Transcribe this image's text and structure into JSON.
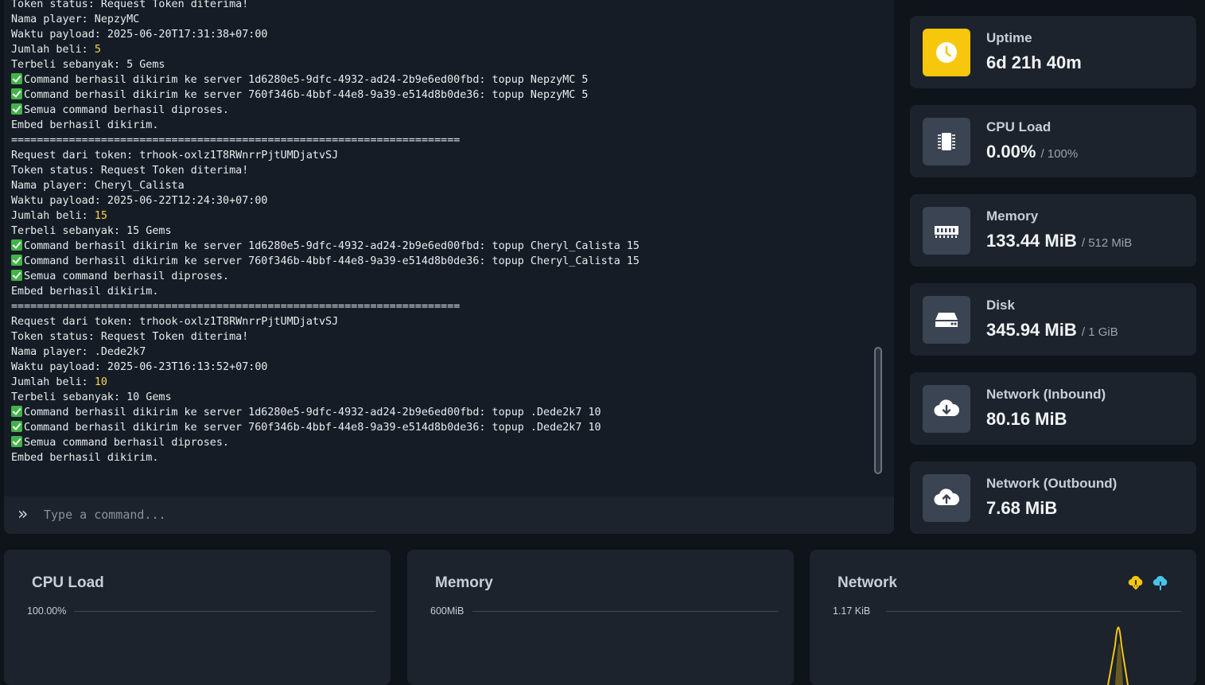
{
  "console": {
    "lines": [
      {
        "text": "Token status: Request Token diterima!"
      },
      {
        "text": "Nama player: NepzyMC"
      },
      {
        "text": "Waktu payload: 2025-06-20T17:31:38+07:00"
      },
      {
        "prefix": "Jumlah beli: ",
        "highlight": "5"
      },
      {
        "text": "Terbeli sebanyak: 5 Gems"
      },
      {
        "check": true,
        "text": "Command berhasil dikirim ke server 1d6280e5-9dfc-4932-ad24-2b9e6ed00fbd: topup NepzyMC 5"
      },
      {
        "check": true,
        "text": "Command berhasil dikirim ke server 760f346b-4bbf-44e8-9a39-e514d8b0de36: topup NepzyMC 5"
      },
      {
        "check": true,
        "text": "Semua command berhasil diproses."
      },
      {
        "text": "Embed berhasil dikirim."
      },
      {
        "text": "======================================================================"
      },
      {
        "text": "Request dari token: trhook-oxlz1T8RWnrrPjtUMDjatvSJ"
      },
      {
        "text": "Token status: Request Token diterima!"
      },
      {
        "text": "Nama player: Cheryl_Calista"
      },
      {
        "text": "Waktu payload: 2025-06-22T12:24:30+07:00"
      },
      {
        "prefix": "Jumlah beli: ",
        "highlight": "15"
      },
      {
        "text": "Terbeli sebanyak: 15 Gems"
      },
      {
        "check": true,
        "text": "Command berhasil dikirim ke server 1d6280e5-9dfc-4932-ad24-2b9e6ed00fbd: topup Cheryl_Calista 15"
      },
      {
        "check": true,
        "text": "Command berhasil dikirim ke server 760f346b-4bbf-44e8-9a39-e514d8b0de36: topup Cheryl_Calista 15"
      },
      {
        "check": true,
        "text": "Semua command berhasil diproses."
      },
      {
        "text": "Embed berhasil dikirim."
      },
      {
        "text": "======================================================================"
      },
      {
        "text": "Request dari token: trhook-oxlz1T8RWnrrPjtUMDjatvSJ"
      },
      {
        "text": "Token status: Request Token diterima!"
      },
      {
        "text": "Nama player: .Dede2k7"
      },
      {
        "text": "Waktu payload: 2025-06-23T16:13:52+07:00"
      },
      {
        "prefix": "Jumlah beli: ",
        "highlight": "10"
      },
      {
        "text": "Terbeli sebanyak: 10 Gems"
      },
      {
        "check": true,
        "text": "Command berhasil dikirim ke server 1d6280e5-9dfc-4932-ad24-2b9e6ed00fbd: topup .Dede2k7 10"
      },
      {
        "check": true,
        "text": "Command berhasil dikirim ke server 760f346b-4bbf-44e8-9a39-e514d8b0de36: topup .Dede2k7 10"
      },
      {
        "check": true,
        "text": "Semua command berhasil diproses."
      },
      {
        "text": "Embed berhasil dikirim."
      }
    ],
    "command_placeholder": "Type a command...",
    "prompt_icon": "double-chevron-right-icon"
  },
  "stats": {
    "uptime": {
      "label": "Uptime",
      "value": "6d 21h 40m",
      "icon": "clock-icon"
    },
    "cpu": {
      "label": "CPU Load",
      "value": "0.00%",
      "limit": "/ 100%",
      "icon": "cpu-chip-icon"
    },
    "memory": {
      "label": "Memory",
      "value": "133.44 MiB",
      "limit": "/ 512 MiB",
      "icon": "memory-icon"
    },
    "disk": {
      "label": "Disk",
      "value": "345.94 MiB",
      "limit": "/ 1 GiB",
      "icon": "hard-drive-icon"
    },
    "net_in": {
      "label": "Network (Inbound)",
      "value": "80.16 MiB",
      "icon": "cloud-download-icon"
    },
    "net_out": {
      "label": "Network (Outbound)",
      "value": "7.68 MiB",
      "icon": "cloud-upload-icon"
    }
  },
  "graphs": {
    "cpu": {
      "title": "CPU Load",
      "max_label": "100.00%"
    },
    "memory": {
      "title": "Memory",
      "max_label": "600MiB"
    },
    "network": {
      "title": "Network",
      "max_label": "1.17 KiB"
    }
  },
  "colors": {
    "accent_yellow": "#f6c70c",
    "inbound": "#f6c70c",
    "outbound": "#46c4ea",
    "success_check": "#41b448"
  }
}
